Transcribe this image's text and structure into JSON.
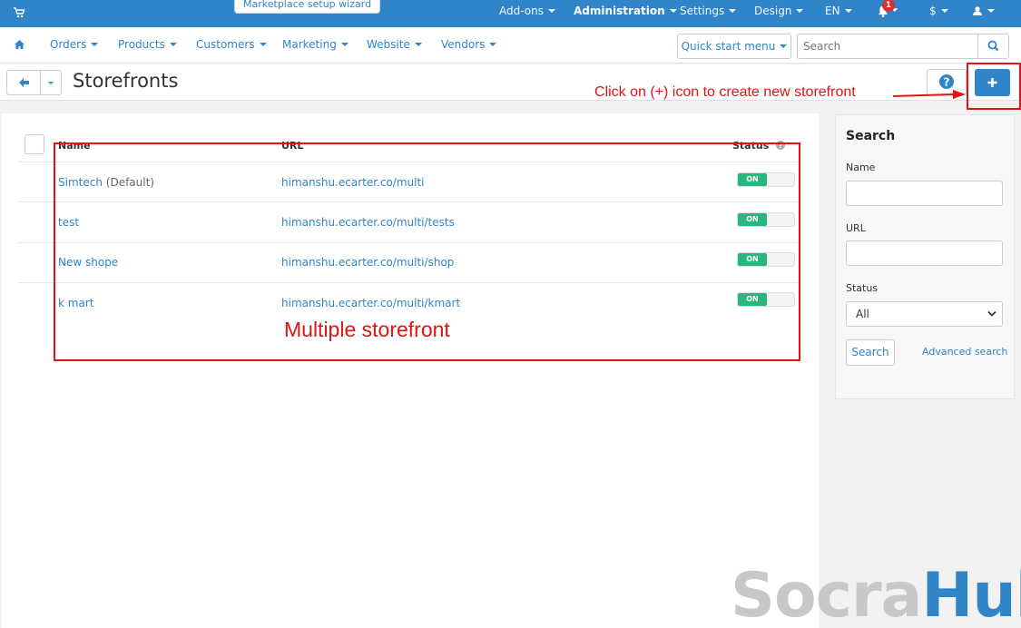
{
  "topbar": {
    "wizard_label": "Marketplace setup wizard",
    "menu": [
      "Add-ons",
      "Administration",
      "Settings",
      "Design",
      "EN",
      "$"
    ],
    "notification_count": "1"
  },
  "nav": {
    "items": [
      "Orders",
      "Products",
      "Customers",
      "Marketing",
      "Website",
      "Vendors"
    ],
    "quick_start": "Quick start menu",
    "search_placeholder": "Search"
  },
  "page": {
    "title": "Storefronts"
  },
  "table": {
    "columns": {
      "name": "Name",
      "url": "URL",
      "status": "Status"
    },
    "rows": [
      {
        "name": "Simtech",
        "suffix": "(Default)",
        "url": "himanshu.ecarter.co/multi",
        "status": "ON"
      },
      {
        "name": "test",
        "suffix": "",
        "url": "himanshu.ecarter.co/multi/tests",
        "status": "ON"
      },
      {
        "name": "New shope",
        "suffix": "",
        "url": "himanshu.ecarter.co/multi/shop",
        "status": "ON"
      },
      {
        "name": "k mart",
        "suffix": "",
        "url": "himanshu.ecarter.co/multi/kmart",
        "status": "ON"
      }
    ]
  },
  "sidebar": {
    "title": "Search",
    "name_label": "Name",
    "url_label": "URL",
    "status_label": "Status",
    "status_value": "All",
    "search_button": "Search",
    "advanced_link": "Advanced search"
  },
  "annotations": {
    "add_hint": "Click on (+) icon to create new storefront",
    "table_hint": "Multiple storefront"
  },
  "watermark": {
    "part1": "Socra",
    "part2": "Hub"
  },
  "colors": {
    "brand": "#2f85c7",
    "toggle_on": "#27b87d",
    "annotation": "#e01414"
  }
}
